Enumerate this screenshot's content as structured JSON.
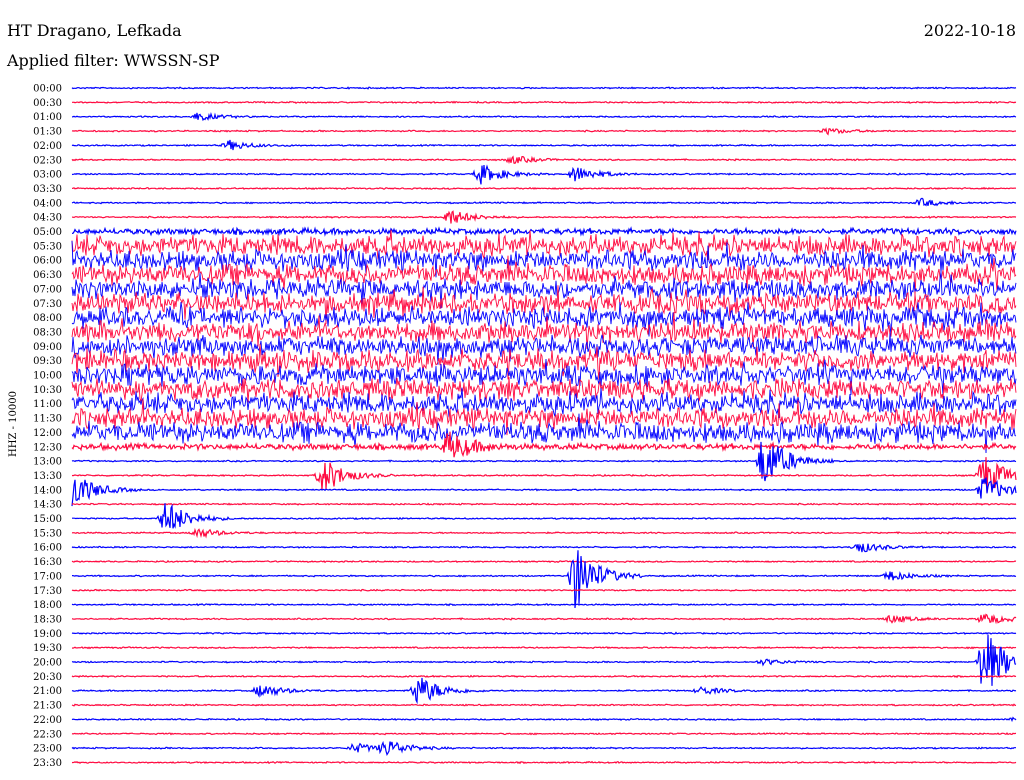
{
  "header": {
    "station": "HT Dragano, Lefkada",
    "date": "2022-10-18",
    "filter_text": "Applied filter: WWSSN-SP"
  },
  "chart_data": {
    "type": "line",
    "ylabel": "HHZ - 10000",
    "rows": [
      "00:00",
      "00:30",
      "01:00",
      "01:30",
      "02:00",
      "02:30",
      "03:00",
      "03:30",
      "04:00",
      "04:30",
      "05:00",
      "05:30",
      "06:00",
      "06:30",
      "07:00",
      "07:30",
      "08:00",
      "08:30",
      "09:00",
      "09:30",
      "10:00",
      "10:30",
      "11:00",
      "11:30",
      "12:00",
      "12:30",
      "13:00",
      "13:30",
      "14:00",
      "14:30",
      "15:00",
      "15:30",
      "16:00",
      "16:30",
      "17:00",
      "17:30",
      "18:00",
      "18:30",
      "19:00",
      "19:30",
      "20:00",
      "20:30",
      "21:00",
      "21:30",
      "22:00",
      "22:30",
      "23:00",
      "23:30"
    ],
    "colors": [
      "#0000ff",
      "#ff0a40"
    ],
    "noisy_period": [
      "05:30",
      "12:00"
    ],
    "events": [
      {
        "row": "01:00",
        "minute": 4,
        "amp": 4
      },
      {
        "row": "01:30",
        "minute": 24,
        "amp": 3
      },
      {
        "row": "02:00",
        "minute": 5,
        "amp": 5
      },
      {
        "row": "02:30",
        "minute": 14,
        "amp": 4
      },
      {
        "row": "03:00",
        "minute": 13,
        "amp": 10
      },
      {
        "row": "03:00",
        "minute": 16,
        "amp": 8
      },
      {
        "row": "04:00",
        "minute": 27,
        "amp": 4
      },
      {
        "row": "04:30",
        "minute": 12,
        "amp": 8
      },
      {
        "row": "12:30",
        "minute": 12,
        "amp": 14
      },
      {
        "row": "13:00",
        "minute": 22,
        "amp": 30
      },
      {
        "row": "13:30",
        "minute": 8,
        "amp": 18
      },
      {
        "row": "13:30",
        "minute": 29,
        "amp": 22
      },
      {
        "row": "14:00",
        "minute": 0,
        "amp": 20
      },
      {
        "row": "14:00",
        "minute": 29,
        "amp": 14
      },
      {
        "row": "15:00",
        "minute": 3,
        "amp": 18
      },
      {
        "row": "15:30",
        "minute": 4,
        "amp": 5
      },
      {
        "row": "16:00",
        "minute": 25,
        "amp": 6
      },
      {
        "row": "17:00",
        "minute": 16,
        "amp": 34
      },
      {
        "row": "17:00",
        "minute": 26,
        "amp": 5
      },
      {
        "row": "18:30",
        "minute": 26,
        "amp": 4
      },
      {
        "row": "18:30",
        "minute": 29,
        "amp": 6
      },
      {
        "row": "20:00",
        "minute": 29,
        "amp": 36
      },
      {
        "row": "20:00",
        "minute": 22,
        "amp": 3
      },
      {
        "row": "21:00",
        "minute": 6,
        "amp": 7
      },
      {
        "row": "21:00",
        "minute": 11,
        "amp": 16
      },
      {
        "row": "21:00",
        "minute": 20,
        "amp": 4
      },
      {
        "row": "22:00",
        "minute": 30,
        "amp": 4
      },
      {
        "row": "23:00",
        "minute": 9,
        "amp": 5
      },
      {
        "row": "23:00",
        "minute": 10,
        "amp": 8
      }
    ]
  }
}
